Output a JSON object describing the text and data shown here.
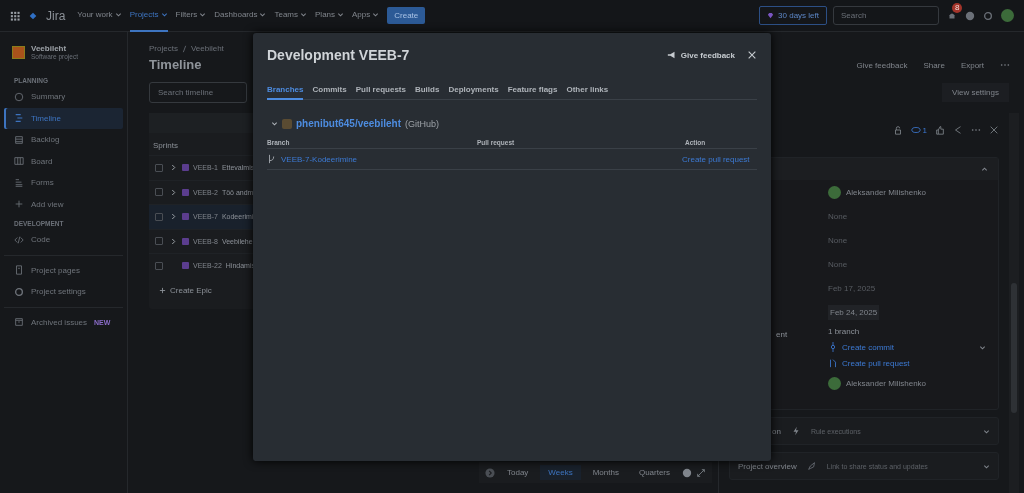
{
  "topbar": {
    "product": "Jira",
    "nav": [
      {
        "label": "Your work",
        "selected": false
      },
      {
        "label": "Projects",
        "selected": true
      },
      {
        "label": "Filters",
        "selected": false
      },
      {
        "label": "Dashboards",
        "selected": false
      },
      {
        "label": "Teams",
        "selected": false
      },
      {
        "label": "Plans",
        "selected": false
      },
      {
        "label": "Apps",
        "selected": false
      }
    ],
    "create": "Create",
    "trial": "30 days left",
    "search": {
      "placeholder": "Search"
    },
    "notifications": "8"
  },
  "sidebar": {
    "project": {
      "name": "Veebileht",
      "type": "Software project"
    },
    "sections": [
      {
        "heading": "PLANNING",
        "items": [
          {
            "label": "Summary",
            "selected": false
          },
          {
            "label": "Timeline",
            "selected": true
          },
          {
            "label": "Backlog",
            "selected": false
          },
          {
            "label": "Board",
            "selected": false
          },
          {
            "label": "Forms",
            "selected": false
          },
          {
            "label": "Add view",
            "selected": false
          }
        ]
      },
      {
        "heading": "DEVELOPMENT",
        "items": [
          {
            "label": "Code",
            "selected": false
          }
        ]
      },
      {
        "items": [
          {
            "label": "Project pages",
            "selected": false
          },
          {
            "label": "Project settings",
            "selected": false
          }
        ]
      },
      {
        "items": [
          {
            "label": "Archived issues",
            "selected": false,
            "badge": "NEW"
          }
        ]
      }
    ]
  },
  "page": {
    "breadcrumb": [
      "Projects",
      "Veebileht"
    ],
    "title": "Timeline",
    "actions": [
      "Give feedback",
      "Share",
      "Export"
    ],
    "search": {
      "placeholder": "Search timeline"
    },
    "view_settings": "View settings"
  },
  "timeline": {
    "column": "Sprints",
    "epics": [
      {
        "key": "VEEB-1",
        "name": "Ettevalmis",
        "expandable": true,
        "selected": false
      },
      {
        "key": "VEEB-2",
        "name": "Töö andm",
        "expandable": true,
        "selected": false
      },
      {
        "key": "VEEB-7",
        "name": "Kodeerimi",
        "expandable": true,
        "selected": true
      },
      {
        "key": "VEEB-8",
        "name": "Veebilehe",
        "expandable": true,
        "selected": false
      },
      {
        "key": "VEEB-22",
        "name": "Hindamis",
        "expandable": false,
        "selected": false
      }
    ],
    "create_epic": "Create Epic",
    "scale": [
      {
        "label": "Today",
        "selected": false
      },
      {
        "label": "Weeks",
        "selected": true
      },
      {
        "label": "Months",
        "selected": false
      },
      {
        "label": "Quarters",
        "selected": false
      }
    ]
  },
  "issue_panel": {
    "watchers": "1",
    "fields": [
      {
        "kind": "person",
        "value": "Aleksander Milishenko"
      },
      {
        "kind": "text",
        "value": "None"
      },
      {
        "kind": "text",
        "value": "None"
      },
      {
        "kind": "text",
        "value": "None"
      },
      {
        "kind": "text",
        "value": "Feb 17, 2025"
      },
      {
        "kind": "chip",
        "value": "Feb 24, 2025"
      },
      {
        "label": "ent",
        "kind": "dev",
        "value": "1 branch",
        "links": [
          "Create commit",
          "Create pull request"
        ]
      },
      {
        "kind": "person",
        "value": "Aleksander Milishenko"
      }
    ],
    "sections": [
      {
        "label": "on",
        "hint": "Rule executions"
      },
      {
        "label": "Project overview",
        "hint": "Link to share status and updates"
      }
    ]
  },
  "modal": {
    "title": "Development VEEB-7",
    "feedback": "Give feedback",
    "tabs": [
      {
        "label": "Branches",
        "selected": true
      },
      {
        "label": "Commits",
        "selected": false
      },
      {
        "label": "Pull requests",
        "selected": false
      },
      {
        "label": "Builds",
        "selected": false
      },
      {
        "label": "Deployments",
        "selected": false
      },
      {
        "label": "Feature flags",
        "selected": false
      },
      {
        "label": "Other links",
        "selected": false
      }
    ],
    "repo": {
      "name": "phenibut645/veebileht",
      "host": "(GitHub)",
      "expanded": true
    },
    "columns": [
      "Branch",
      "Pull request",
      "Action"
    ],
    "rows": [
      {
        "branch": "VEEB-7-Kodeerimine",
        "pull_request": "",
        "action": "Create pull request"
      }
    ]
  }
}
